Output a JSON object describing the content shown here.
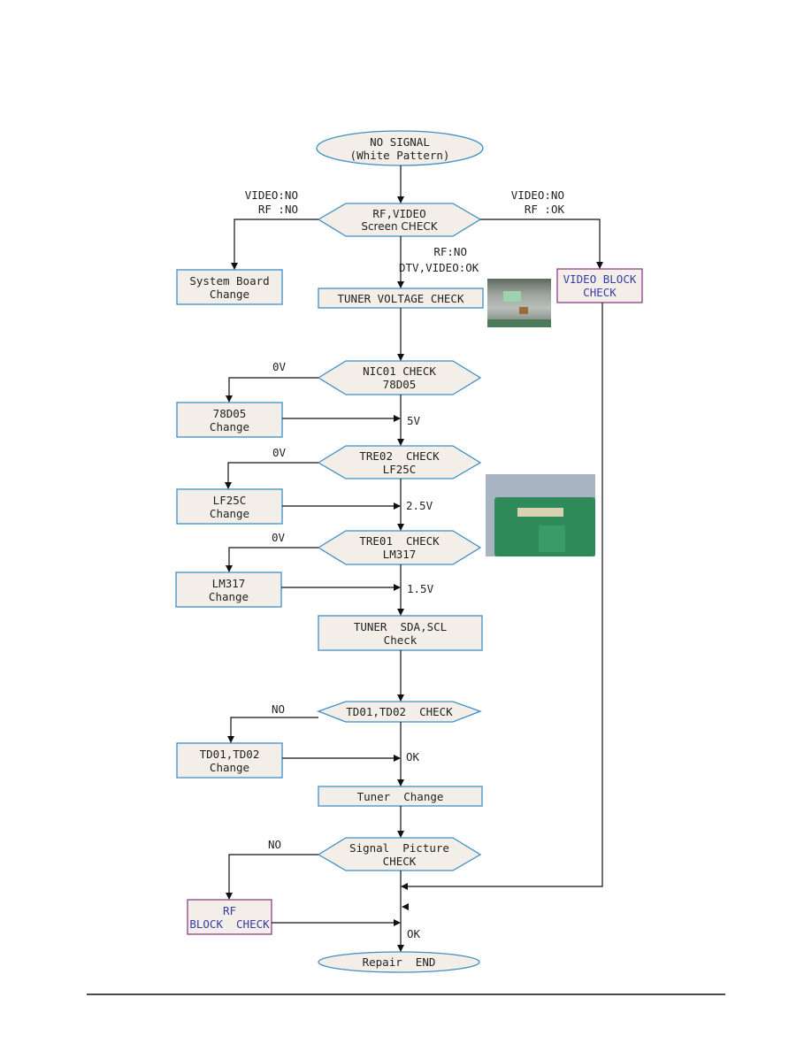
{
  "colors": {
    "node_fill": "#f3efe8",
    "node_border": "#3d8fc6",
    "alt_border": "#8c3f8c",
    "alt_text": "#3a3aa8",
    "line": "#111111"
  },
  "nodes": {
    "start": [
      "NO SIGNAL",
      "(White Pattern)"
    ],
    "screen_check": [
      "RF,VIDEO",
      "Screen CHECK"
    ],
    "system_board": [
      "System Board",
      "Change"
    ],
    "video_block": [
      "VIDEO BLOCK",
      "CHECK"
    ],
    "tuner_voltage": [
      "TUNER VOLTAGE CHECK"
    ],
    "nic01": [
      "NIC01 CHECK",
      "78D05"
    ],
    "c78d05": [
      "78D05",
      "Change"
    ],
    "tre02": [
      "TRE02  CHECK",
      "LF25C"
    ],
    "lf25c": [
      "LF25C",
      "Change"
    ],
    "tre01": [
      "TRE01  CHECK",
      "LM317"
    ],
    "lm317": [
      "LM317",
      "Change"
    ],
    "tuner_sda": [
      "TUNER  SDA,SCL",
      "Check"
    ],
    "td_check": [
      "TD01,TD02  CHECK"
    ],
    "td_change": [
      "TD01,TD02",
      "Change"
    ],
    "tuner_change": [
      "Tuner  Change"
    ],
    "signal_picture": [
      "Signal  Picture",
      "CHECK"
    ],
    "rf_block": [
      "RF",
      "BLOCK  CHECK"
    ],
    "end": [
      "Repair  END"
    ]
  },
  "edge_labels": {
    "left_video": "VIDEO:NO",
    "left_rf": "RF :NO",
    "right_video": "VIDEO:NO",
    "right_rf": "RF :OK",
    "down_rf": "RF:NO",
    "down_dtv": "DTV,VIDEO:OK",
    "nic_0v": "0V",
    "v5": "5V",
    "tre02_0v": "0V",
    "v25": "2.5V",
    "tre01_0v": "0V",
    "v15": "1.5V",
    "td_no": "NO",
    "td_ok": "OK",
    "sig_no": "NO",
    "end_ok": "OK"
  },
  "photos": {
    "tuner_photo": "tuner-module-photo",
    "board_photo": "circuit-board-photo"
  }
}
